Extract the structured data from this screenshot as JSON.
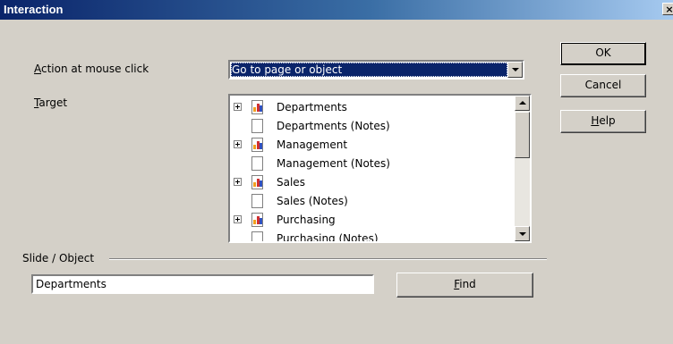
{
  "window": {
    "title": "Interaction",
    "close_glyph": "×"
  },
  "form": {
    "action_label": "Action at mouse click",
    "action_label_key": "A",
    "action_label_rest": "ction at mouse click",
    "action_value": "Go to page or object",
    "target_label_key": "T",
    "target_label_rest": "arget"
  },
  "tree": {
    "items": [
      {
        "label": "Departments",
        "type": "slide",
        "expandable": true
      },
      {
        "label": "Departments (Notes)",
        "type": "notes",
        "expandable": false
      },
      {
        "label": "Management",
        "type": "slide",
        "expandable": true
      },
      {
        "label": "Management (Notes)",
        "type": "notes",
        "expandable": false
      },
      {
        "label": "Sales",
        "type": "slide",
        "expandable": true
      },
      {
        "label": "Sales (Notes)",
        "type": "notes",
        "expandable": false
      },
      {
        "label": "Purchasing",
        "type": "slide",
        "expandable": true
      },
      {
        "label": "Purchasing (Notes)",
        "type": "notes",
        "expandable": false
      }
    ],
    "slide_icon_colors": [
      "#f0a020",
      "#d03030",
      "#3050c0"
    ]
  },
  "slide_object": {
    "section_label": "Slide / Object",
    "value": "Departments",
    "find_key": "F",
    "find_rest": "ind"
  },
  "buttons": {
    "ok": "OK",
    "cancel": "Cancel",
    "help_key": "H",
    "help_rest": "elp"
  }
}
